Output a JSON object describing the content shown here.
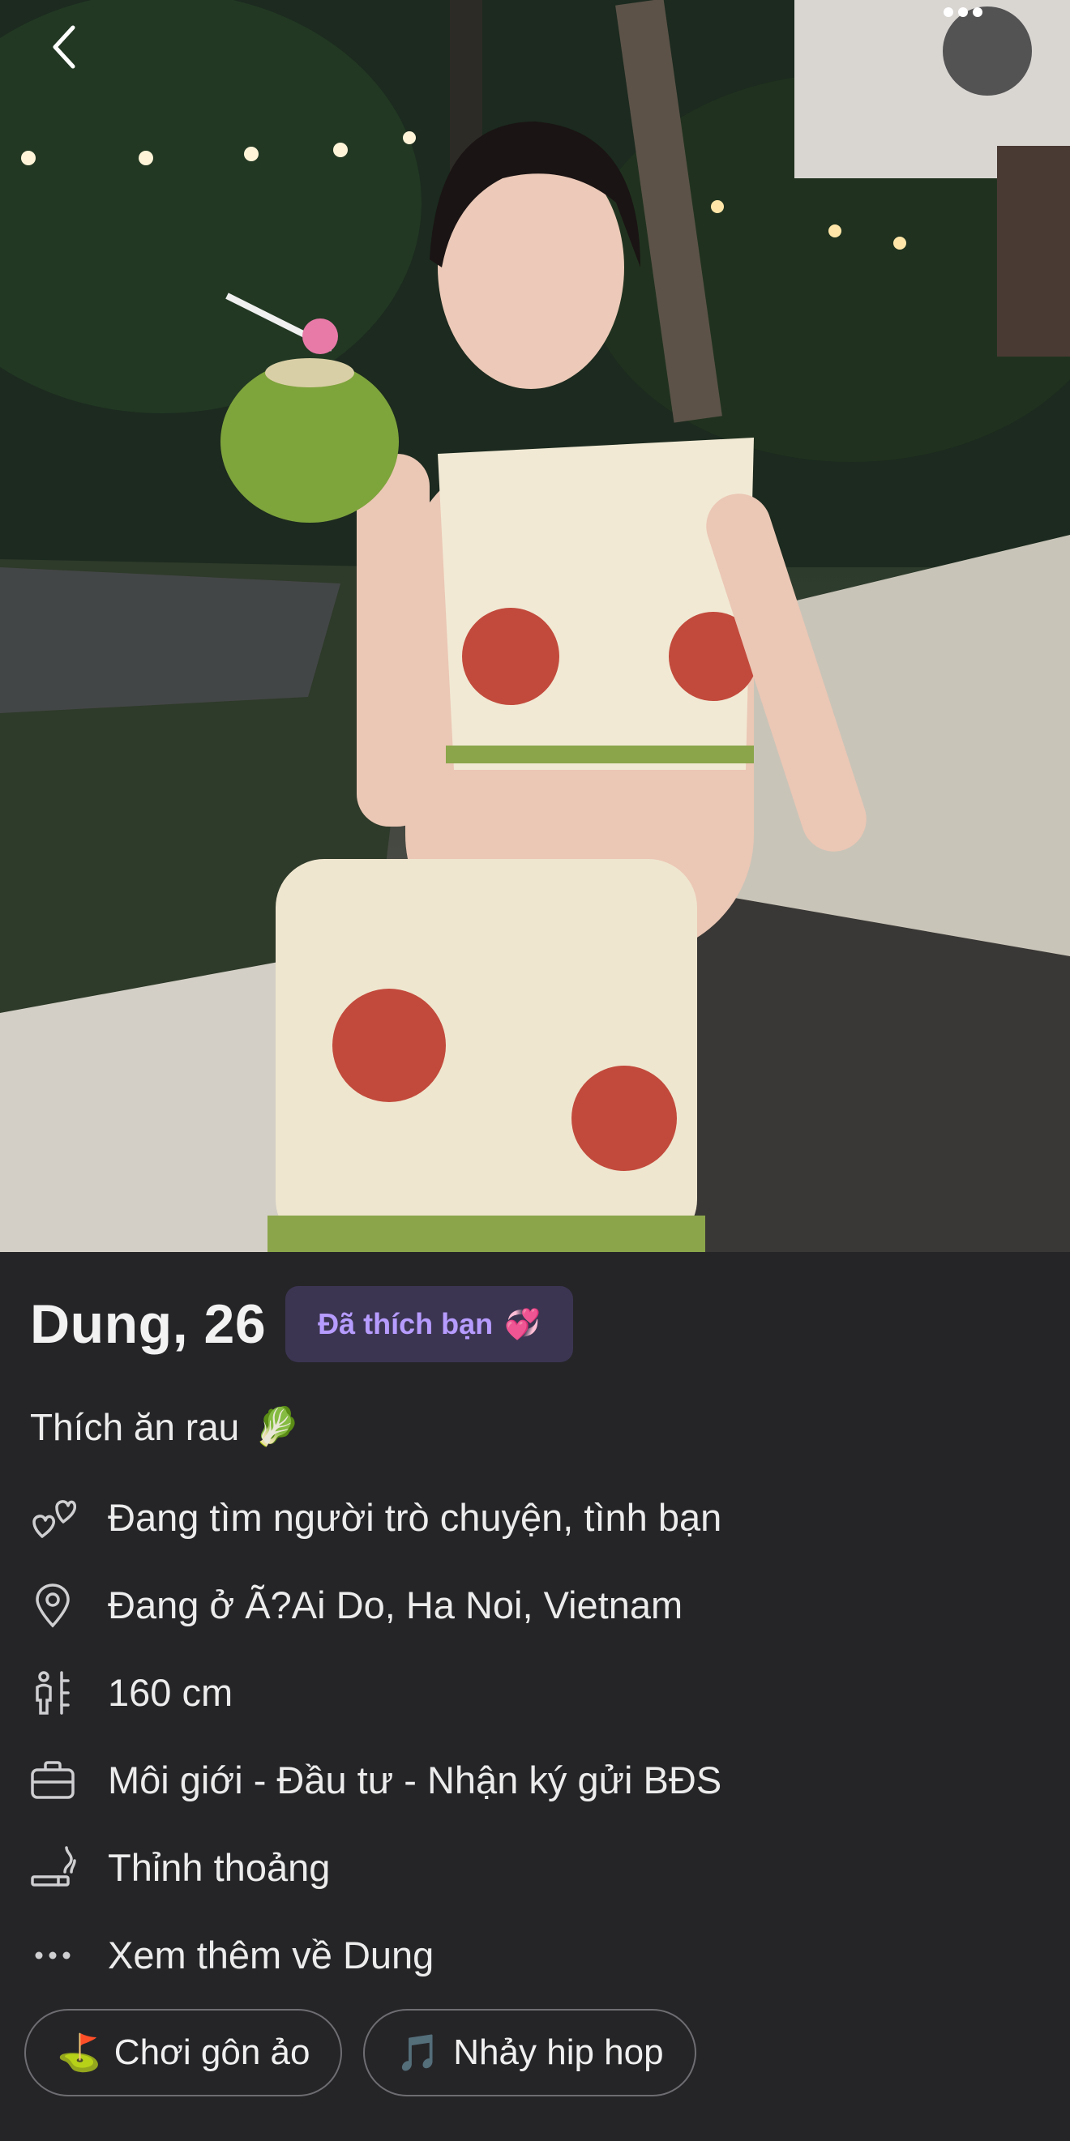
{
  "photo": {
    "alt": ""
  },
  "nav": {
    "back_icon": "chevron-left-icon",
    "more_icon": "ellipsis-icon"
  },
  "profile": {
    "name_age": "Dung, 26",
    "liked_badge": "Đã thích bạn",
    "liked_emoji": "💞",
    "bio": "Thích ăn rau",
    "bio_emoji": "🥬"
  },
  "details": [
    {
      "icon": "hearts-icon",
      "text": "Đang tìm người trò chuyện, tình bạn"
    },
    {
      "icon": "location-pin-icon",
      "text": "Đang ở Ã?Ai Do, Ha Noi, Vietnam"
    },
    {
      "icon": "height-icon",
      "text": "160 cm"
    },
    {
      "icon": "briefcase-icon",
      "text": "Môi giới - Đầu tư - Nhận ký gửi BĐS"
    },
    {
      "icon": "smoking-icon",
      "text": "Thỉnh thoảng"
    },
    {
      "icon": "more-dots-icon",
      "text": "Xem thêm về Dung"
    }
  ],
  "interests": [
    {
      "emoji": "⛳",
      "label": "Chơi gôn ảo"
    },
    {
      "emoji": "🎵",
      "label": "Nhảy hip hop"
    }
  ],
  "colors": {
    "background": "#252528",
    "badge_bg": "#3c3552",
    "badge_text": "#b79cff",
    "chip_border": "#6e6e72"
  }
}
